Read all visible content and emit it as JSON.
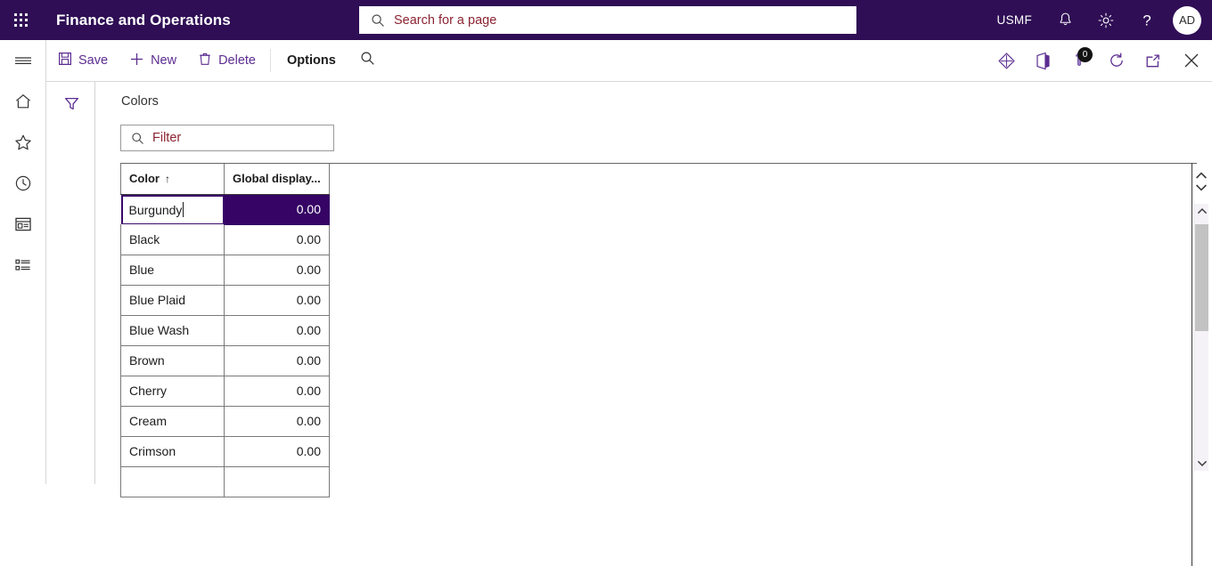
{
  "header": {
    "waffle_label": "app-launcher",
    "title": "Finance and Operations",
    "search_placeholder": "Search for a page",
    "search_value": "",
    "company": "USMF",
    "icons": [
      "notifications-bell-icon",
      "settings-gear-icon",
      "help-question-icon"
    ],
    "avatar_initials": "AD",
    "background_color": "#2F0E55"
  },
  "command_bar": {
    "buttons": [
      {
        "id": "save",
        "label": "Save",
        "icon": "save-floppy-icon"
      },
      {
        "id": "new",
        "label": "New",
        "icon": "plus-icon"
      },
      {
        "id": "delete",
        "label": "Delete",
        "icon": "trash-icon"
      },
      {
        "id": "options",
        "label": "Options",
        "icon": null
      }
    ],
    "search_icon": "search-icon",
    "right_icons": [
      {
        "id": "personalize",
        "icon": "diamond-personalize-icon"
      },
      {
        "id": "office",
        "icon": "office-app-icon"
      },
      {
        "id": "attachments",
        "icon": "attachment-icon",
        "badge": "0"
      },
      {
        "id": "refresh",
        "icon": "refresh-icon"
      },
      {
        "id": "popout",
        "icon": "open-in-new-window-icon"
      },
      {
        "id": "close",
        "icon": "close-x-icon"
      }
    ]
  },
  "nav_rail": {
    "items": [
      {
        "id": "menu",
        "icon": "hamburger-menu-icon"
      },
      {
        "id": "home",
        "icon": "home-icon"
      },
      {
        "id": "favorites",
        "icon": "star-icon"
      },
      {
        "id": "recent",
        "icon": "clock-recent-icon"
      },
      {
        "id": "workspaces",
        "icon": "workspace-window-icon"
      },
      {
        "id": "modules",
        "icon": "module-list-icon"
      }
    ]
  },
  "filter_pane": {
    "icon": "filter-funnel-icon"
  },
  "main": {
    "page_title": "Colors",
    "filter": {
      "placeholder": "Filter",
      "value": "",
      "icon": "search-icon"
    },
    "grid": {
      "columns": [
        {
          "id": "color",
          "label": "Color",
          "sort": "↑",
          "align": "left"
        },
        {
          "id": "global_display",
          "label": "Global display...",
          "align": "right"
        }
      ],
      "rows": [
        {
          "color": "Burgundy",
          "value": "0.00",
          "editing": true,
          "selected_cell": "global_display"
        },
        {
          "color": "Black",
          "value": "0.00"
        },
        {
          "color": "Blue",
          "value": "0.00"
        },
        {
          "color": "Blue Plaid",
          "value": "0.00"
        },
        {
          "color": "Blue Wash",
          "value": "0.00"
        },
        {
          "color": "Brown",
          "value": "0.00"
        },
        {
          "color": "Cherry",
          "value": "0.00"
        },
        {
          "color": "Cream",
          "value": "0.00"
        },
        {
          "color": "Crimson",
          "value": "0.00"
        },
        {
          "color": "",
          "value": ""
        }
      ]
    },
    "selection_color": "#350464",
    "edit_border_color": "#3B0A6B"
  },
  "scrollbars": {
    "record_nav_up": "chevron-up-icon",
    "record_nav_down": "chevron-down-icon",
    "scroll_up": "scroll-up-arrow-icon",
    "scroll_down": "scroll-down-arrow-icon"
  }
}
